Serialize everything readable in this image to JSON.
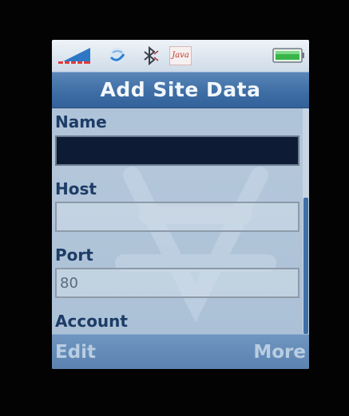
{
  "status_bar": {
    "signal_icon": "signal-strength-icon",
    "connection_icon": "connection-swirl-icon",
    "bluetooth_icon": "bluetooth-icon",
    "java_badge": "Java",
    "battery_icon": "battery-icon"
  },
  "header": {
    "title": "Add Site Data"
  },
  "form": {
    "fields": [
      {
        "label": "Name",
        "value": "",
        "placeholder": ""
      },
      {
        "label": "Host",
        "value": "",
        "placeholder": ""
      },
      {
        "label": "Port",
        "value": "80",
        "placeholder": ""
      },
      {
        "label": "Account",
        "value": "",
        "placeholder": ""
      }
    ]
  },
  "softkeys": {
    "left": "Edit",
    "right": "More"
  },
  "colors": {
    "title_bar": "#3e6ea5",
    "label_text": "#1d3c66",
    "focused_input": "#0d1c34",
    "softkey_bar": "#5b82b0"
  }
}
